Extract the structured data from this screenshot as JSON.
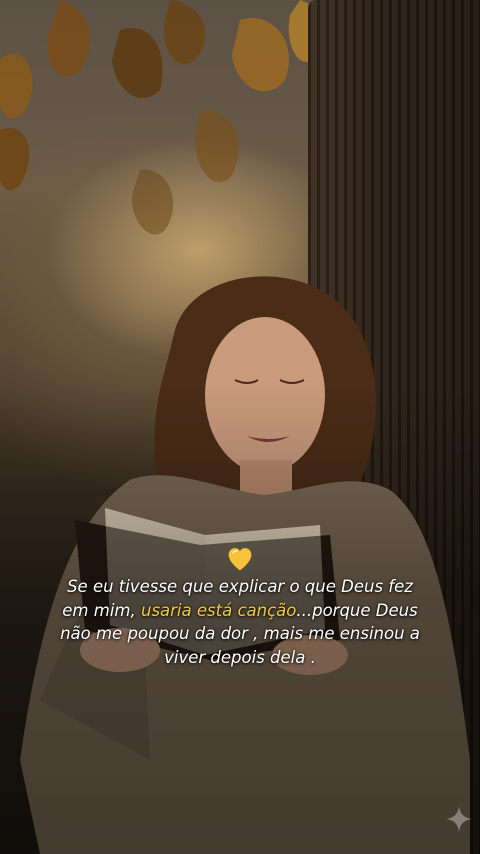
{
  "caption": {
    "emoji": "yellow-heart-icon",
    "part1": "Se eu tivesse que explicar o que Deus fez em mim, ",
    "highlight": "usaria está canção",
    "part2": "...porque Deus não me poupou da dor , mais me ensinou a viver depois dela .",
    "highlight_color": "#f3cb3a",
    "text_color": "#ffffff"
  },
  "icons": {
    "heart": "yellow-heart-icon",
    "corner": "sparkle-icon"
  }
}
